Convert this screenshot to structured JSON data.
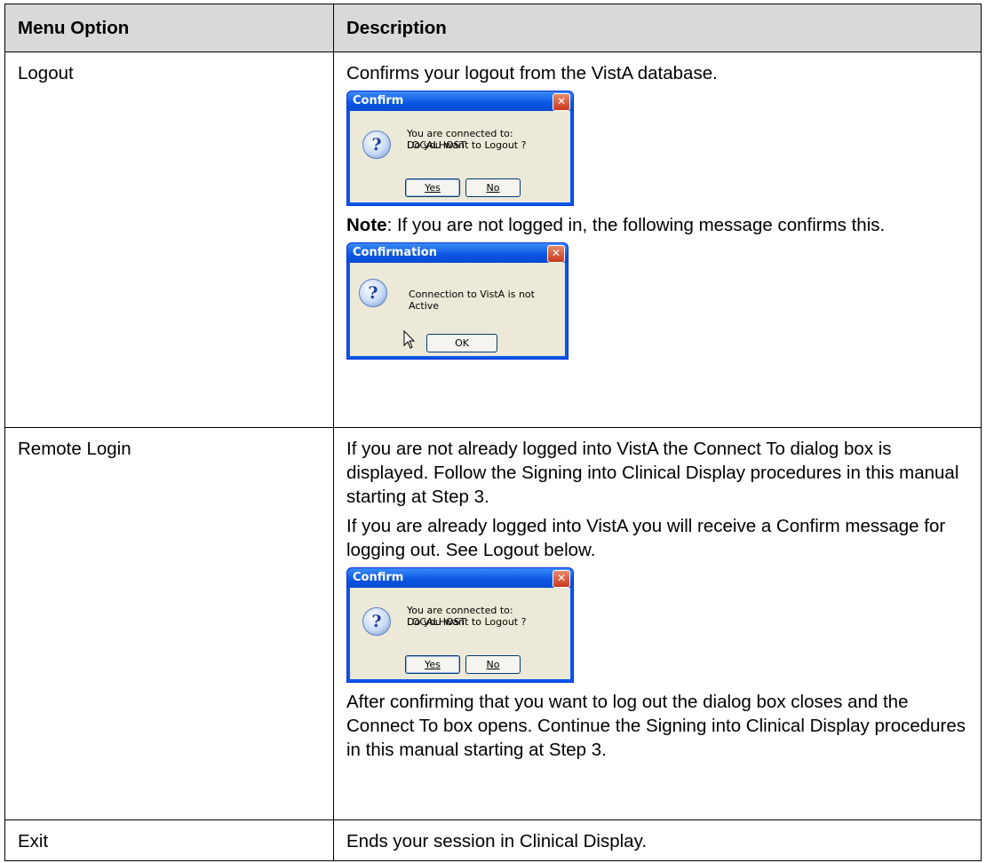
{
  "table": {
    "header": {
      "col1": "Menu Option",
      "col2": "Description"
    },
    "logout": {
      "option": "Logout",
      "desc": "Confirms your logout from the VistA database.",
      "note_label": "Note",
      "note_text": ": If you are not logged in, the following message confirms this."
    },
    "remote": {
      "option": "Remote Login",
      "p1": "If you are not already logged into VistA the Connect To dialog box is displayed. Follow the Signing into Clinical Display procedures in this manual starting at Step 3.",
      "p2": "If you are already logged into VistA you will receive a Confirm message for logging out. See Logout below.",
      "p3": "After confirming that you want to log out the dialog box closes and the Connect To box opens. Continue the Signing into Clinical Display procedures in this manual starting at Step 3."
    },
    "exit": {
      "option": "Exit",
      "desc": "Ends your session in Clinical Display."
    }
  },
  "confirm_dialog": {
    "title": "Confirm",
    "line1": "You are connected to: LOCALHOST",
    "line2": "Do you want to Logout ?",
    "yes_label": "Yes",
    "no_label": "No",
    "icon": "question-icon"
  },
  "confirmation_dialog": {
    "title": "Confirmation",
    "message": "Connection to VistA is not Active",
    "ok_label": "OK",
    "icon": "question-icon"
  }
}
